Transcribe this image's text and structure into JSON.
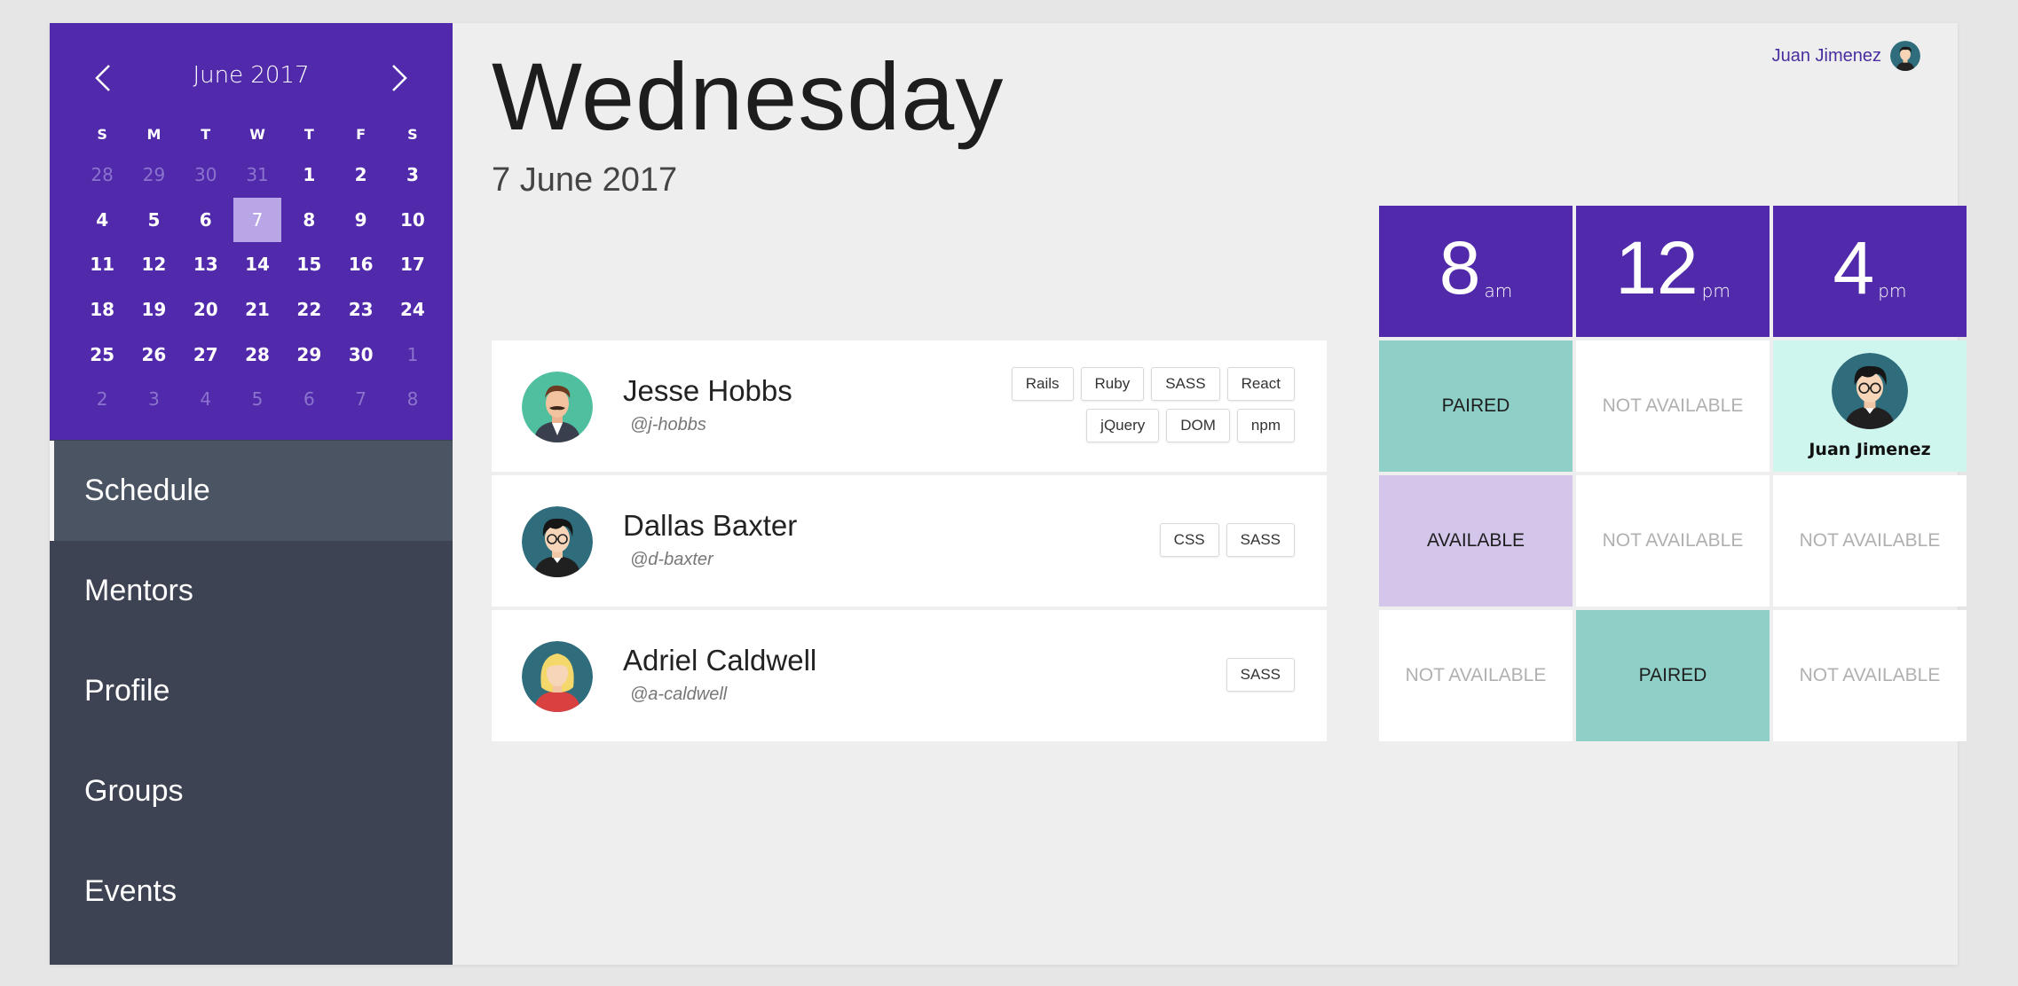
{
  "calendar": {
    "title": "June 2017",
    "weekdays": [
      "S",
      "M",
      "T",
      "W",
      "T",
      "F",
      "S"
    ],
    "days": [
      [
        "28",
        "29",
        "30",
        "31",
        "1",
        "2",
        "3"
      ],
      [
        "4",
        "5",
        "6",
        "7",
        "8",
        "9",
        "10"
      ],
      [
        "11",
        "12",
        "13",
        "14",
        "15",
        "16",
        "17"
      ],
      [
        "18",
        "19",
        "20",
        "21",
        "22",
        "23",
        "24"
      ],
      [
        "25",
        "26",
        "27",
        "28",
        "29",
        "30",
        "1"
      ],
      [
        "2",
        "3",
        "4",
        "5",
        "6",
        "7",
        "8"
      ]
    ],
    "selected_day": "7"
  },
  "nav": {
    "items": [
      {
        "label": "Schedule",
        "active": true
      },
      {
        "label": "Mentors"
      },
      {
        "label": "Profile"
      },
      {
        "label": "Groups"
      },
      {
        "label": "Events"
      }
    ]
  },
  "header": {
    "day": "Wednesday",
    "date": "7 June 2017",
    "user_name": "Juan Jimenez"
  },
  "slots": [
    {
      "num": "8",
      "suffix": "am"
    },
    {
      "num": "12",
      "suffix": "pm"
    },
    {
      "num": "4",
      "suffix": "pm"
    }
  ],
  "rows": [
    {
      "name": "Jesse Hobbs",
      "handle": "@j-hobbs",
      "tags": [
        "Rails",
        "Ruby",
        "SASS",
        "React",
        "jQuery",
        "DOM",
        "npm"
      ],
      "cells": [
        {
          "status": "PAIRED"
        },
        {
          "status": "NOT AVAILABLE"
        },
        {
          "booked_by": "Juan Jimenez"
        }
      ]
    },
    {
      "name": "Dallas Baxter",
      "handle": "@d-baxter",
      "tags": [
        "CSS",
        "SASS"
      ],
      "cells": [
        {
          "status": "AVAILABLE"
        },
        {
          "status": "NOT AVAILABLE"
        },
        {
          "status": "NOT AVAILABLE"
        }
      ]
    },
    {
      "name": "Adriel Caldwell",
      "handle": "@a-caldwell",
      "tags": [
        "SASS"
      ],
      "cells": [
        {
          "status": "NOT AVAILABLE"
        },
        {
          "status": "PAIRED"
        },
        {
          "status": "NOT AVAILABLE"
        }
      ]
    }
  ],
  "colors": {
    "brand_purple": "#5129ab",
    "sidebar": "#3d4352",
    "paired": "#8ecfc7",
    "available": "#d4c5ea",
    "booked": "#cff5ef"
  }
}
